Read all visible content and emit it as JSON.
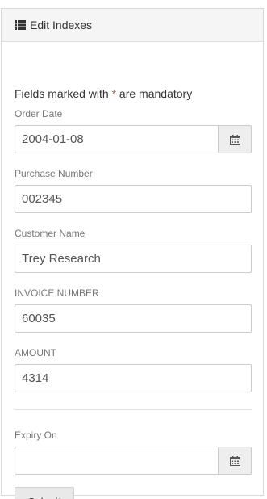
{
  "header": {
    "title": "Edit Indexes",
    "icon": "list-icon"
  },
  "form": {
    "mandatory_prefix": "Fields marked with ",
    "mandatory_star": "*",
    "mandatory_suffix": " are mandatory",
    "order_date": {
      "label": "Order Date",
      "value": "2004-01-08"
    },
    "purchase_number": {
      "label": "Purchase Number",
      "value": "002345"
    },
    "customer_name": {
      "label": "Customer Name",
      "value": "Trey Research"
    },
    "invoice_number": {
      "label": "INVOICE NUMBER",
      "value": "60035"
    },
    "amount": {
      "label": "AMOUNT",
      "value": "4314"
    },
    "expiry_on": {
      "label": "Expiry On",
      "value": ""
    },
    "submit_label": "Submit"
  },
  "colors": {
    "mandatory_star": "#d9534f",
    "addon_bg": "#eeeeee",
    "header_bg": "#f5f5f5"
  }
}
